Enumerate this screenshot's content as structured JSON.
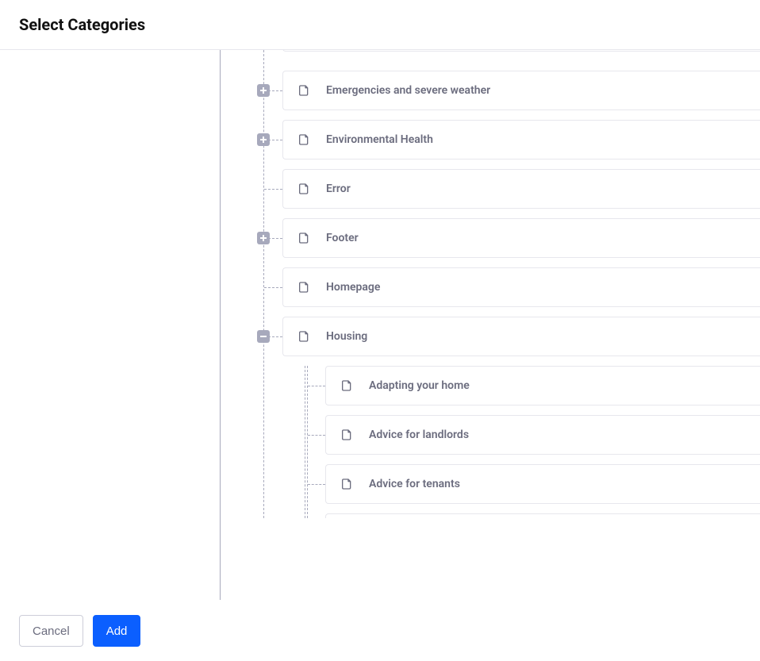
{
  "header": {
    "title": "Select Categories"
  },
  "tree": {
    "level1": [
      {
        "key": "emergencies",
        "label": "Emergencies and severe weather",
        "toggle": "plus"
      },
      {
        "key": "env-health",
        "label": "Environmental Health",
        "toggle": "plus"
      },
      {
        "key": "error",
        "label": "Error",
        "toggle": "none"
      },
      {
        "key": "footer-page",
        "label": "Footer",
        "toggle": "plus"
      },
      {
        "key": "homepage",
        "label": "Homepage",
        "toggle": "none"
      },
      {
        "key": "housing",
        "label": "Housing",
        "toggle": "minus"
      }
    ],
    "housing_children": [
      {
        "key": "adapting",
        "label": "Adapting your home"
      },
      {
        "key": "landlords",
        "label": "Advice for landlords"
      },
      {
        "key": "tenants",
        "label": "Advice for tenants"
      }
    ]
  },
  "footer": {
    "cancel_label": "Cancel",
    "add_label": "Add"
  },
  "icons": {
    "page": "page-icon",
    "plus": "plus-icon",
    "minus": "minus-icon"
  },
  "colors": {
    "primary": "#0b5fff",
    "muted_text": "#6b6c7e",
    "border": "#e7e7ed",
    "guide": "#a7a9bc"
  }
}
